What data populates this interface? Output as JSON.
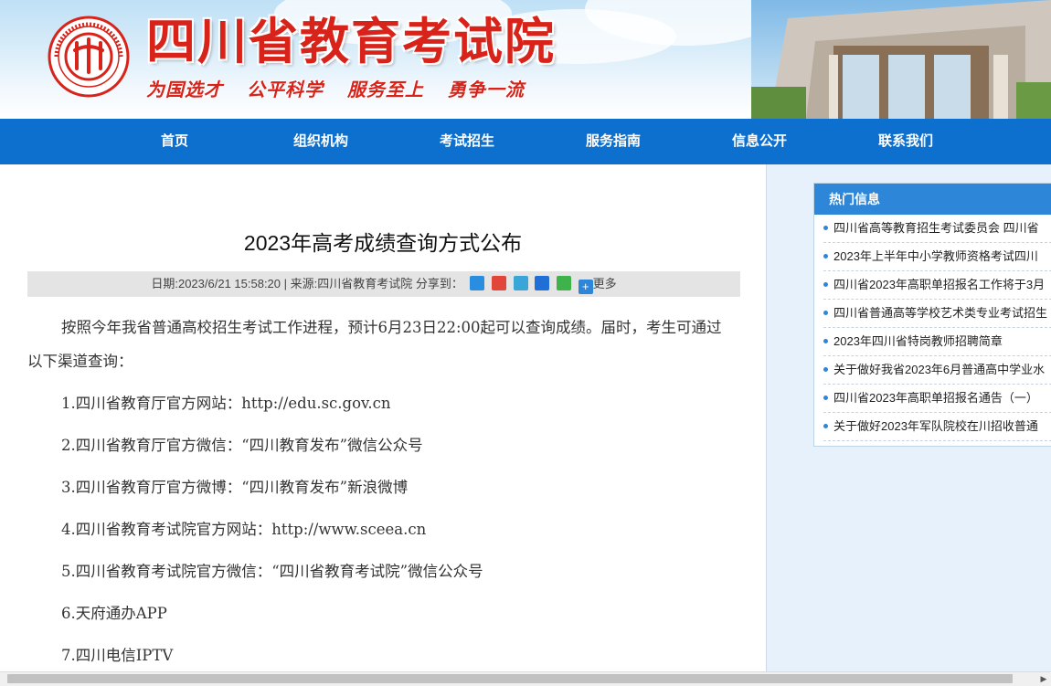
{
  "header": {
    "site_title": "四川省教育考试院",
    "slogans": [
      "为国选才",
      "公平科学",
      "服务至上",
      "勇争一流"
    ]
  },
  "nav": {
    "items": [
      "首页",
      "组织机构",
      "考试招生",
      "服务指南",
      "信息公开",
      "联系我们"
    ]
  },
  "article": {
    "title": "2023年高考成绩查询方式公布",
    "meta": "日期:2023/6/21 15:58:20 | 来源:四川省教育考试院   分享到：",
    "share_more": "更多",
    "intro": "按照今年我省普通高校招生考试工作进程，预计6月23日22:00起可以查询成绩。届时，考生可通过以下渠道查询：",
    "items": [
      "1.四川省教育厅官方网站：http://edu.sc.gov.cn",
      "2.四川省教育厅官方微信：“四川教育发布”微信公众号",
      "3.四川省教育厅官方微博：“四川教育发布”新浪微博",
      "4.四川省教育考试院官方网站：http://www.sceea.cn",
      "5.四川省教育考试院官方微信：“四川省教育考试院”微信公众号",
      "6.天府通办APP",
      "7.四川电信IPTV"
    ]
  },
  "sidebar": {
    "heading": "热门信息",
    "items": [
      "四川省高等教育招生考试委员会 四川省",
      "2023年上半年中小学教师资格考试四川",
      "四川省2023年高职单招报名工作将于3月",
      "四川省普通高等学校艺术类专业考试招生",
      "2023年四川省特岗教师招聘简章",
      "关于做好我省2023年6月普通高中学业水",
      "四川省2023年高职单招报名通告（一）",
      "关于做好2023年军队院校在川招收普通"
    ]
  },
  "colors": {
    "brand_red": "#d7231a",
    "nav_blue": "#0d6fce",
    "side_header_blue": "#2d86d8",
    "meta_bar_gray": "#e4e4e4"
  }
}
